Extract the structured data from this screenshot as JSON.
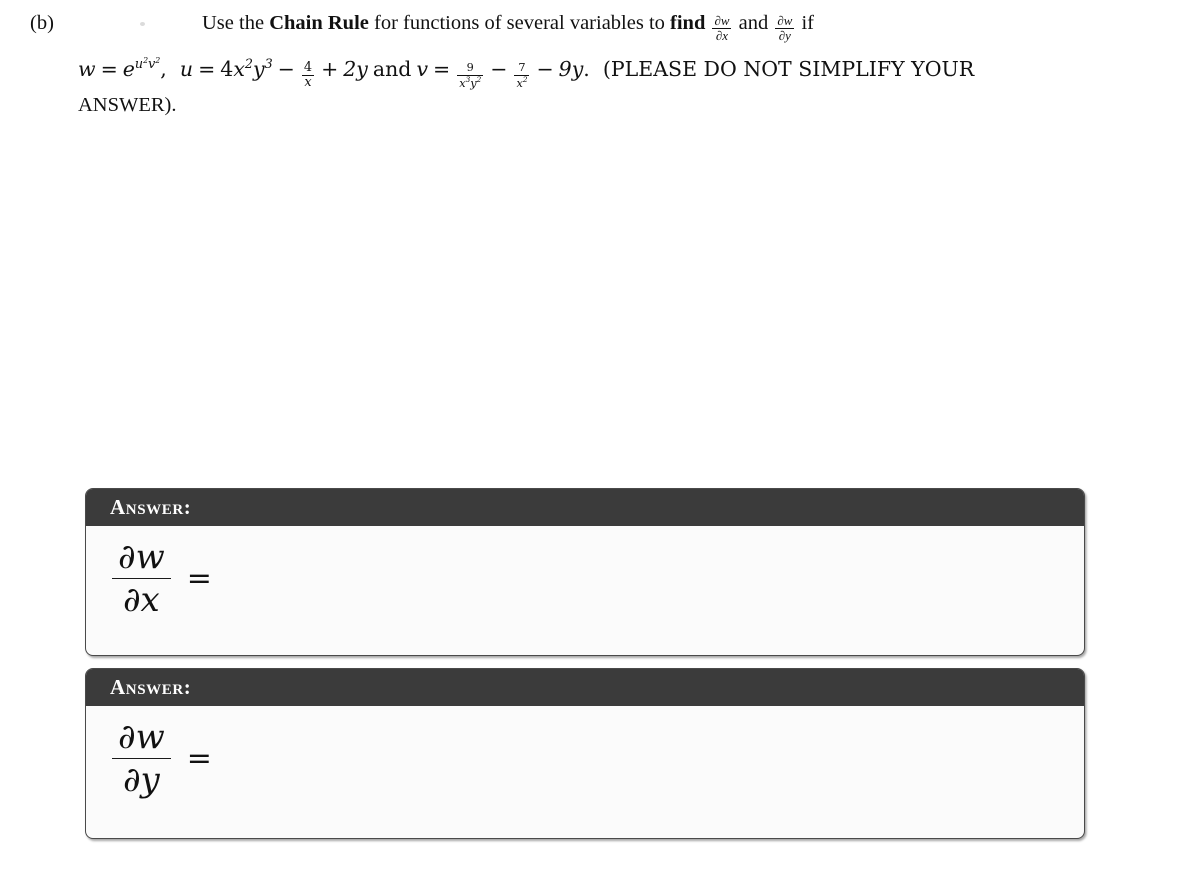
{
  "problem": {
    "part_label": "(b)",
    "line1": {
      "t1": "Use the ",
      "bold1": "Chain Rule",
      "t2": " for functions of several variables to ",
      "bold2": "find",
      "frac1": {
        "num": "∂w",
        "den": "∂x"
      },
      "t3": " and ",
      "frac2": {
        "num": "∂w",
        "den": "∂y"
      },
      "t4": " if"
    },
    "line2": {
      "w_var": "w",
      "eq": "=",
      "w_base": "e",
      "w_exp_u": "u",
      "w_exp_u_pow": "2",
      "w_exp_v": "v",
      "w_exp_v_pow": "2",
      "comma": ",",
      "u_var": "u",
      "u_coef": "4",
      "u_x": "x",
      "u_x_pow": "2",
      "u_y": "y",
      "u_y_pow": "3",
      "minus": "−",
      "u_frac_num": "4",
      "u_frac_den": "x",
      "plus": "+",
      "u_last": "2y",
      "and": "and",
      "v_var": "v",
      "v_frac_num": "9",
      "v_frac_den_x": "x",
      "v_frac_den_x_pow": "3",
      "v_frac_den_y": "y",
      "v_frac_den_y_pow": "2",
      "v_frac2_num": "7",
      "v_frac2_den": "x",
      "v_frac2_den_pow": "2",
      "v_last": "9y",
      "period": ".",
      "note": "(PLEASE DO NOT SIMPLIFY YOUR"
    },
    "line3": "ANSWER)."
  },
  "answers": [
    {
      "header_label": "Answer:",
      "frac_num": "∂w",
      "frac_den": "∂x",
      "equals": "=",
      "value": ""
    },
    {
      "header_label": "Answer:",
      "frac_num": "∂w",
      "frac_den": "∂y",
      "equals": "=",
      "value": ""
    }
  ],
  "colors": {
    "page_background": "#ffffff",
    "header_bar": "#3b3b3b",
    "header_text": "#ffffff",
    "card_body": "#fbfbfb",
    "card_border": "#4a4a4a",
    "text": "#111111"
  }
}
